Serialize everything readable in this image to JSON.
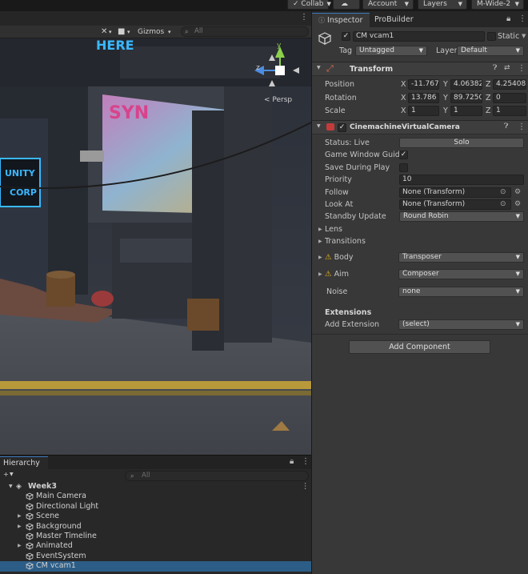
{
  "toolbar": {
    "collab": "Collab",
    "account": "Account",
    "layers": "Layers",
    "layout": "M-Wide-2"
  },
  "scene": {
    "gizmos": "Gizmos",
    "search_placeholder": "All",
    "persp": "< Persp",
    "axis_y": "y",
    "axis_z": "z",
    "sign1": "HERE",
    "sign2_line1": "UNITY",
    "sign2_line2": "CORP",
    "billboard": "SYN"
  },
  "hierarchy": {
    "tab": "Hierarchy",
    "search_placeholder": "All",
    "root": "Week3",
    "items": [
      {
        "label": "Main Camera",
        "expandable": false
      },
      {
        "label": "Directional Light",
        "expandable": false
      },
      {
        "label": "Scene",
        "expandable": true
      },
      {
        "label": "Background",
        "expandable": true
      },
      {
        "label": "Master Timeline",
        "expandable": false
      },
      {
        "label": "Animated",
        "expandable": true
      },
      {
        "label": "EventSystem",
        "expandable": false
      },
      {
        "label": "CM vcam1",
        "expandable": false,
        "selected": true
      }
    ]
  },
  "inspector": {
    "tab_inspector": "Inspector",
    "tab_probuilder": "ProBuilder",
    "object_name": "CM vcam1",
    "static_label": "Static",
    "tag_label": "Tag",
    "tag_value": "Untagged",
    "layer_label": "Layer",
    "layer_value": "Default",
    "transform": {
      "title": "Transform",
      "position_label": "Position",
      "rotation_label": "Rotation",
      "scale_label": "Scale",
      "position": {
        "x": "-11.767C",
        "y": "4.06382",
        "z": "4.25408"
      },
      "rotation": {
        "x": "13.786",
        "y": "89.7250",
        "z": "0"
      },
      "scale": {
        "x": "1",
        "y": "1",
        "z": "1"
      },
      "axis_x": "X",
      "axis_y": "Y",
      "axis_z": "Z"
    },
    "vcam": {
      "title": "CinemachineVirtualCamera",
      "status_label": "Status: Live",
      "solo_button": "Solo",
      "game_window_guides": "Game Window Guides",
      "save_during_play": "Save During Play",
      "priority_label": "Priority",
      "priority_value": "10",
      "follow_label": "Follow",
      "follow_value": "None (Transform)",
      "lookat_label": "Look At",
      "lookat_value": "None (Transform)",
      "standby_label": "Standby Update",
      "standby_value": "Round Robin",
      "lens": "Lens",
      "transitions": "Transitions",
      "body_label": "Body",
      "body_value": "Transposer",
      "aim_label": "Aim",
      "aim_value": "Composer",
      "noise_label": "Noise",
      "noise_value": "none",
      "extensions_title": "Extensions",
      "add_extension_label": "Add Extension",
      "add_extension_value": "(select)"
    },
    "add_component": "Add Component"
  },
  "colors": {
    "accent": "#3a79bb",
    "selection": "#2c5d87",
    "warning": "#e6b422",
    "neon_blue": "#39b8ff"
  }
}
